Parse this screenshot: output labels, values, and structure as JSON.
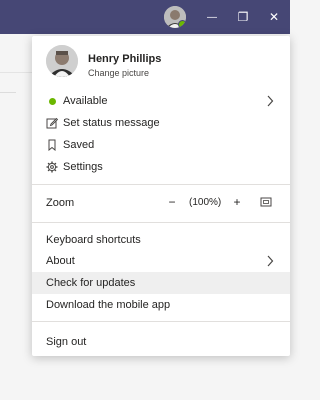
{
  "titlebar": {
    "minimize_glyph": "—",
    "maximize_glyph": "❐",
    "close_glyph": "✕",
    "background": "#464775"
  },
  "profile": {
    "name": "Henry Phillips",
    "change_picture": "Change picture"
  },
  "menu": {
    "status": {
      "label": "Available",
      "color": "#6bb700",
      "icon": "presence-available-icon"
    },
    "set_status": {
      "label": "Set status message",
      "icon": "edit-icon"
    },
    "saved": {
      "label": "Saved",
      "icon": "bookmark-icon"
    },
    "settings": {
      "label": "Settings",
      "icon": "gear-icon"
    },
    "zoom": {
      "label": "Zoom",
      "minus": "−",
      "value": "(100%)",
      "plus": "+",
      "fit_icon": "fit-screen-icon"
    },
    "keyboard_shortcuts": "Keyboard shortcuts",
    "about": "About",
    "check_updates": "Check for updates",
    "download_mobile": "Download the mobile app",
    "sign_out": "Sign out"
  }
}
